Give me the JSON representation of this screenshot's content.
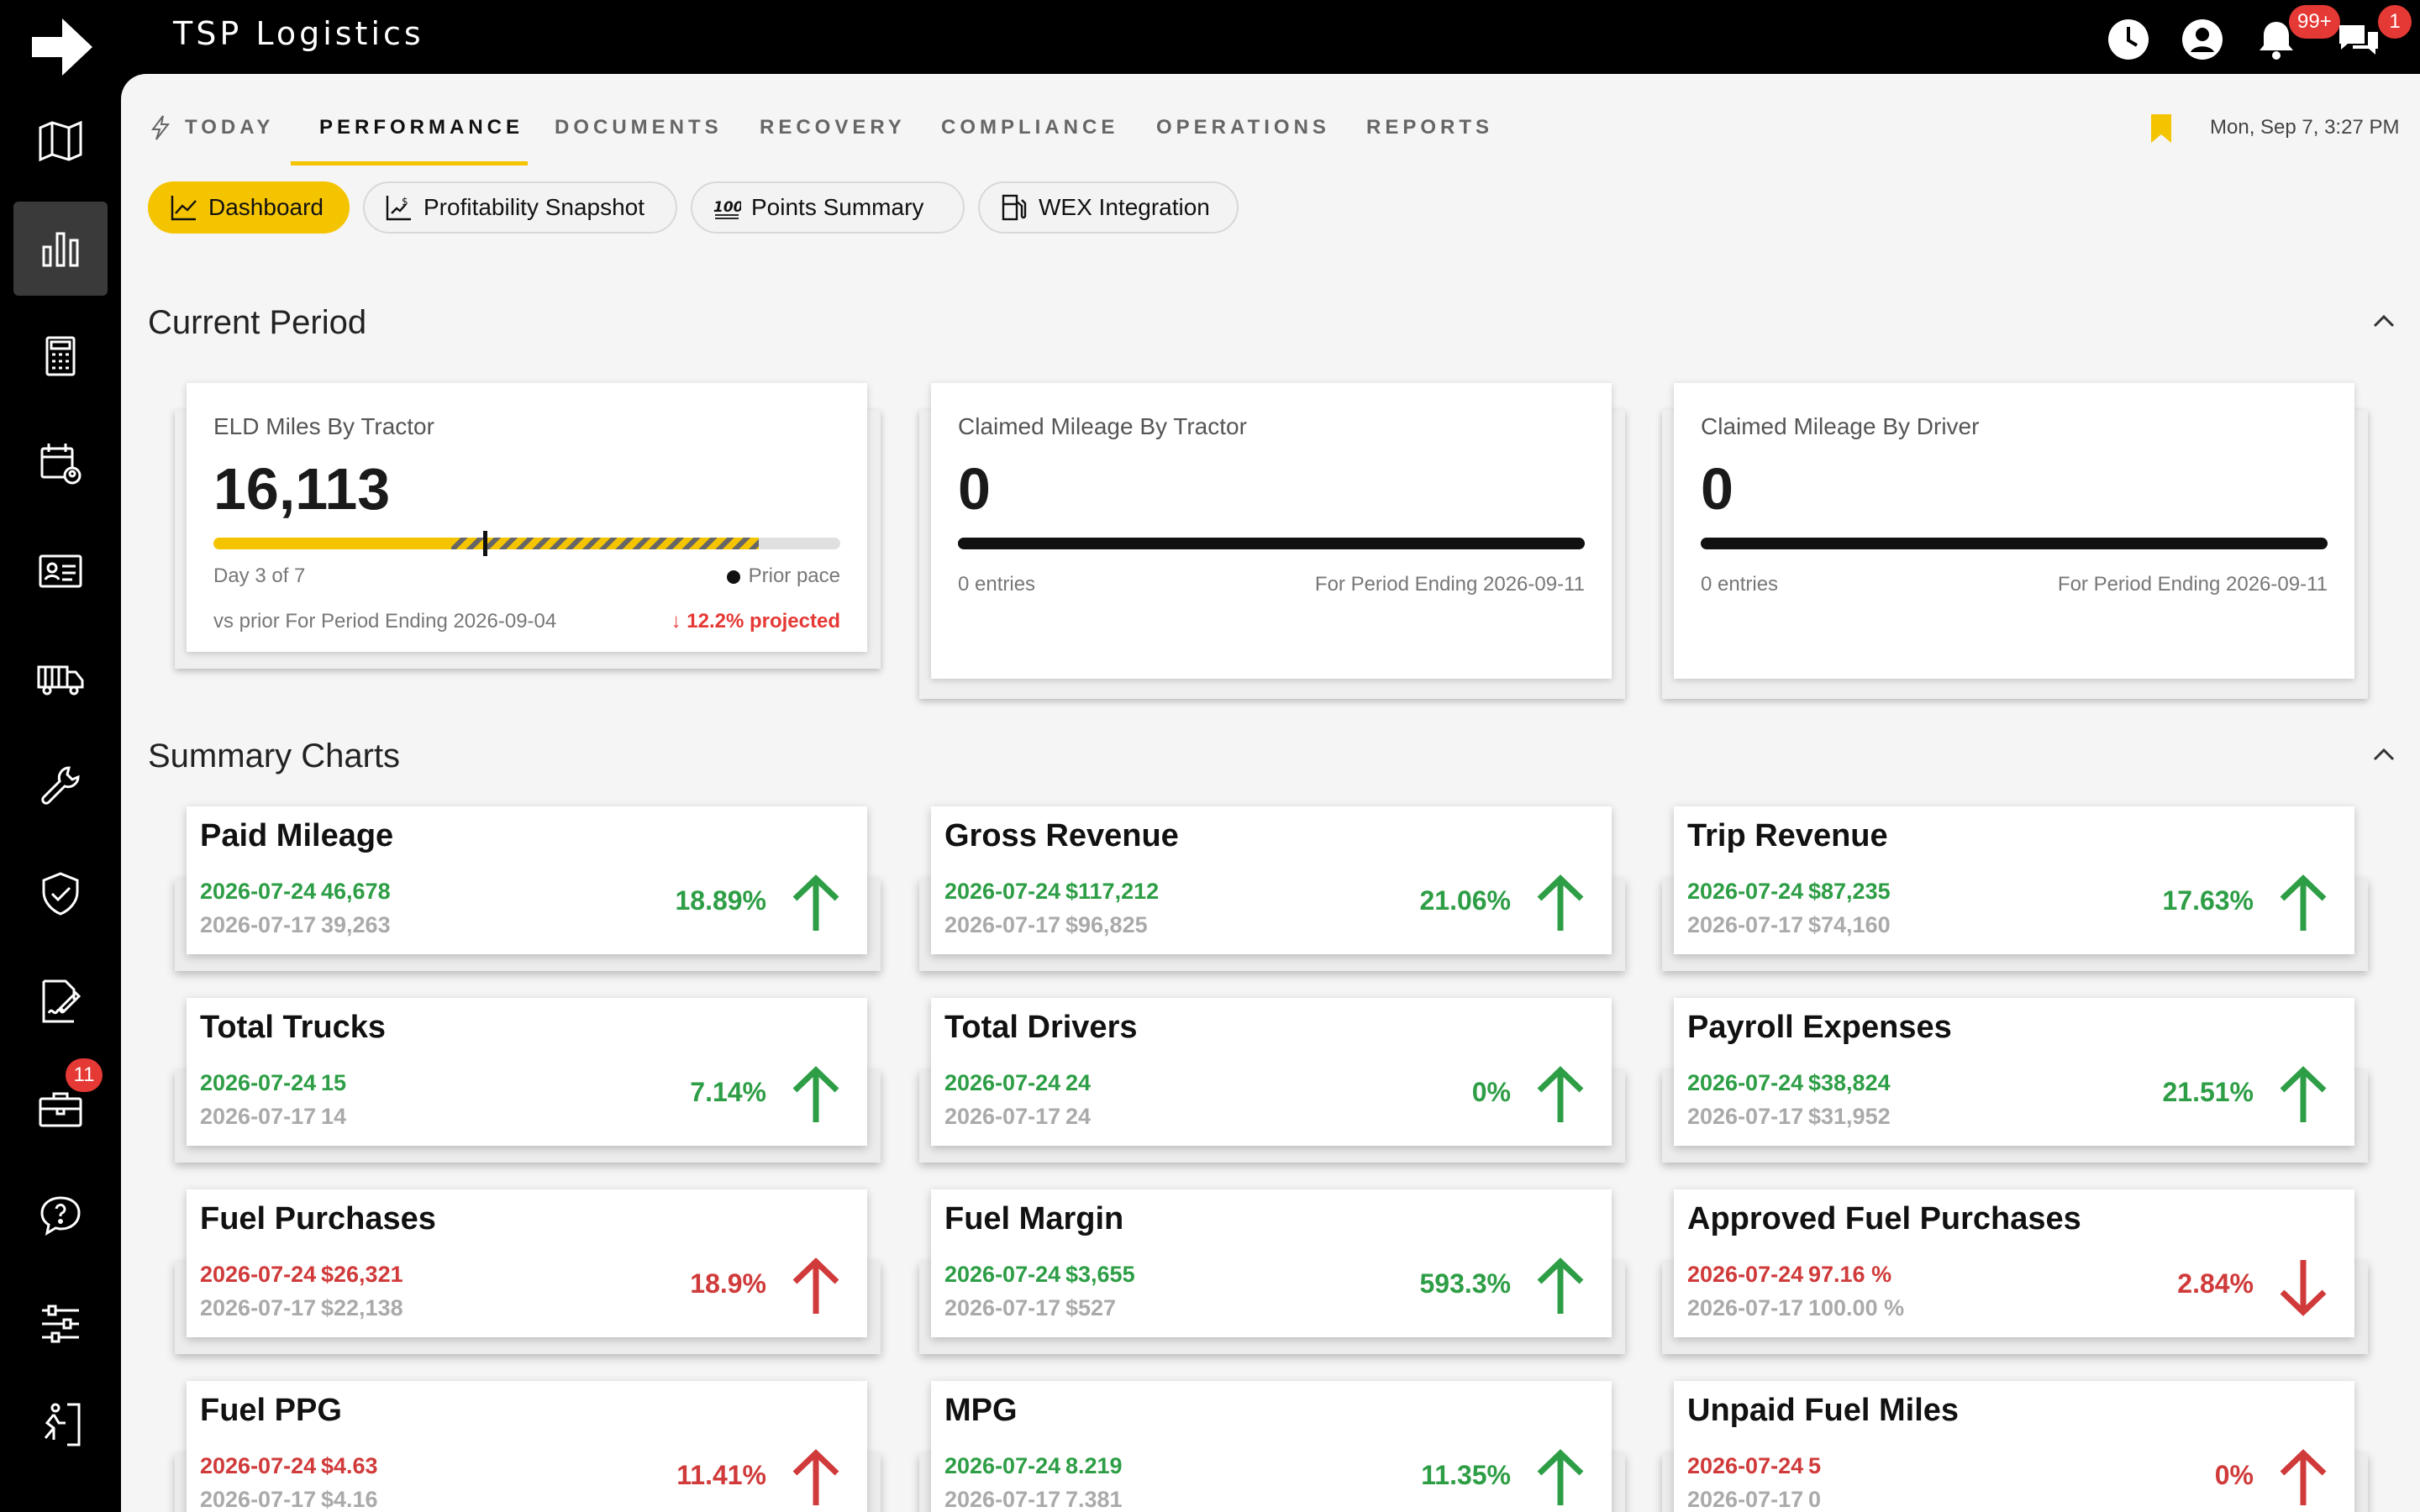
{
  "app": {
    "title": "TSP Logistics"
  },
  "topbar": {
    "icons": [
      "clock-icon",
      "account-icon",
      "bell-icon",
      "chat-icon"
    ],
    "notifications_badge": "99+",
    "messages_badge": "1"
  },
  "sidebar": {
    "items": [
      {
        "icon": "map-icon"
      },
      {
        "icon": "bar-chart-icon",
        "active": true
      },
      {
        "icon": "calculator-icon"
      },
      {
        "icon": "calendar-person-icon"
      },
      {
        "icon": "id-card-icon"
      },
      {
        "icon": "truck-icon"
      },
      {
        "icon": "wrench-icon"
      },
      {
        "icon": "shield-check-icon"
      },
      {
        "icon": "signature-icon"
      },
      {
        "icon": "briefcase-icon",
        "badge": "11"
      },
      {
        "icon": "help-chat-icon"
      },
      {
        "icon": "sliders-icon"
      },
      {
        "icon": "runner-exit-icon"
      }
    ]
  },
  "tabs": [
    "TODAY",
    "PERFORMANCE",
    "DOCUMENTS",
    "RECOVERY",
    "COMPLIANCE",
    "OPERATIONS",
    "REPORTS"
  ],
  "active_tab": "PERFORMANCE",
  "datetime": "Mon, Sep 7, 3:27 PM",
  "subnav": [
    "Dashboard",
    "Profitability Snapshot",
    "Points Summary",
    "WEX Integration"
  ],
  "current_period": {
    "title": "Current Period",
    "eld": {
      "label": "ELD Miles By Tractor",
      "value": "16,113",
      "progress_fraction": 0.38,
      "projected_fraction": 0.87,
      "prior_pace_fraction": 0.43,
      "day": "Day 3 of 7",
      "prior_pace": "Prior pace",
      "vs_prior": "vs prior For Period Ending 2026-09-04",
      "projected": "↓ 12.2% projected"
    },
    "claimed_tractor": {
      "label": "Claimed Mileage By Tractor",
      "value": "0",
      "entries": "0 entries",
      "period": "For Period Ending 2026-09-11"
    },
    "claimed_driver": {
      "label": "Claimed Mileage By Driver",
      "value": "0",
      "entries": "0 entries",
      "period": "For Period Ending 2026-09-11"
    }
  },
  "summary": {
    "title": "Summary Charts",
    "cards": [
      {
        "title": "Paid Mileage",
        "cur_date": "2026-07-24",
        "cur_val": "46,678",
        "prev_date": "2026-07-17",
        "prev_val": "39,263",
        "pct": "18.89%",
        "tone": "green",
        "dir": "up"
      },
      {
        "title": "Gross Revenue",
        "cur_date": "2026-07-24",
        "cur_val": "$117,212",
        "prev_date": "2026-07-17",
        "prev_val": "$96,825",
        "pct": "21.06%",
        "tone": "green",
        "dir": "up"
      },
      {
        "title": "Trip Revenue",
        "cur_date": "2026-07-24",
        "cur_val": "$87,235",
        "prev_date": "2026-07-17",
        "prev_val": "$74,160",
        "pct": "17.63%",
        "tone": "green",
        "dir": "up"
      },
      {
        "title": "Total Trucks",
        "cur_date": "2026-07-24",
        "cur_val": "15",
        "prev_date": "2026-07-17",
        "prev_val": "14",
        "pct": "7.14%",
        "tone": "green",
        "dir": "up"
      },
      {
        "title": "Total Drivers",
        "cur_date": "2026-07-24",
        "cur_val": "24",
        "prev_date": "2026-07-17",
        "prev_val": "24",
        "pct": "0%",
        "tone": "green",
        "dir": "up"
      },
      {
        "title": "Payroll Expenses",
        "cur_date": "2026-07-24",
        "cur_val": "$38,824",
        "prev_date": "2026-07-17",
        "prev_val": "$31,952",
        "pct": "21.51%",
        "tone": "green",
        "dir": "up"
      },
      {
        "title": "Fuel Purchases",
        "cur_date": "2026-07-24",
        "cur_val": "$26,321",
        "prev_date": "2026-07-17",
        "prev_val": "$22,138",
        "pct": "18.9%",
        "tone": "red",
        "dir": "up"
      },
      {
        "title": "Fuel Margin",
        "cur_date": "2026-07-24",
        "cur_val": "$3,655",
        "prev_date": "2026-07-17",
        "prev_val": "$527",
        "pct": "593.3%",
        "tone": "green",
        "dir": "up"
      },
      {
        "title": "Approved Fuel Purchases",
        "cur_date": "2026-07-24",
        "cur_val": "97.16 %",
        "prev_date": "2026-07-17",
        "prev_val": "100.00 %",
        "pct": "2.84%",
        "tone": "red",
        "dir": "down"
      },
      {
        "title": "Fuel PPG",
        "cur_date": "2026-07-24",
        "cur_val": "$4.63",
        "prev_date": "2026-07-17",
        "prev_val": "$4.16",
        "pct": "11.41%",
        "tone": "red",
        "dir": "up"
      },
      {
        "title": "MPG",
        "cur_date": "2026-07-24",
        "cur_val": "8.219",
        "prev_date": "2026-07-17",
        "prev_val": "7.381",
        "pct": "11.35%",
        "tone": "green",
        "dir": "up"
      },
      {
        "title": "Unpaid Fuel Miles",
        "cur_date": "2026-07-24",
        "cur_val": "5",
        "prev_date": "2026-07-17",
        "prev_val": "0",
        "pct": "0%",
        "tone": "red",
        "dir": "up"
      }
    ]
  },
  "colors": {
    "accent": "#f5c400",
    "up_green": "#2e9e46",
    "down_red": "#d03a3a",
    "badge": "#e53935"
  }
}
